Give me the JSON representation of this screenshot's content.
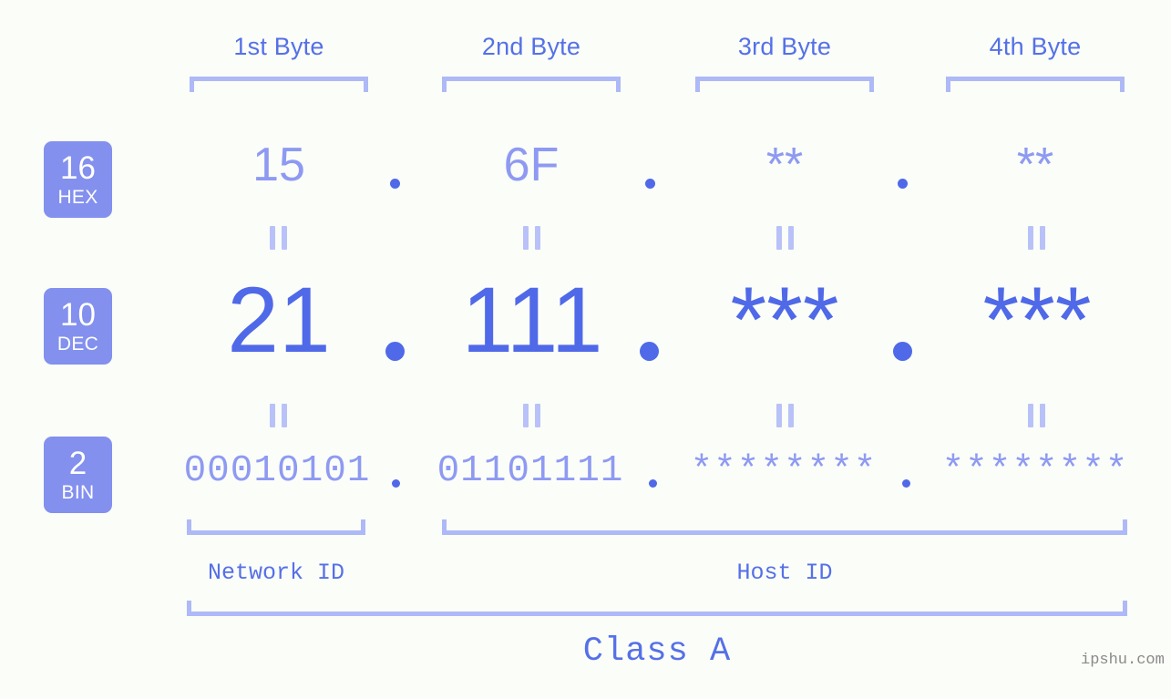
{
  "page": {
    "background_color": "#fbfdf8",
    "accent_dark": "#4f69e8",
    "accent_mid": "#5570e8",
    "accent_light": "#8e9af2",
    "accent_bracket": "#aeb9f7",
    "badge_bg": "#8390ee"
  },
  "byte_headers": [
    {
      "label": "1st Byte"
    },
    {
      "label": "2nd Byte"
    },
    {
      "label": "3rd Byte"
    },
    {
      "label": "4th Byte"
    }
  ],
  "rows": [
    {
      "badge": {
        "base": "16",
        "name": "HEX"
      },
      "values": [
        "15",
        "6F",
        "**",
        "**"
      ],
      "separator": "."
    },
    {
      "badge": {
        "base": "10",
        "name": "DEC"
      },
      "values": [
        "21",
        "111",
        "***",
        "***"
      ],
      "separator": "."
    },
    {
      "badge": {
        "base": "2",
        "name": "BIN"
      },
      "values": [
        "00010101",
        "01101111",
        "********",
        "********"
      ],
      "separator": "."
    }
  ],
  "equals_symbol": "=",
  "footer": {
    "network_id_label": "Network ID",
    "host_id_label": "Host ID",
    "class_label": "Class A",
    "watermark": "ipshu.com"
  }
}
